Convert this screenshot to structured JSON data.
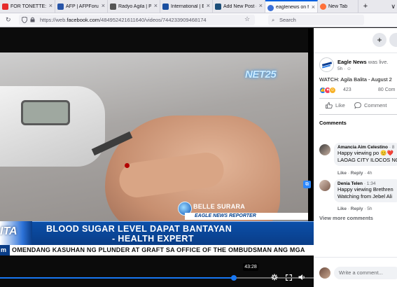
{
  "browser": {
    "tabs": [
      {
        "title": "FOR TONETTE:",
        "favicon_color": "#e62b2b",
        "active": false
      },
      {
        "title": "AFP | AFPForum",
        "favicon_color": "#2855a8",
        "active": false
      },
      {
        "title": "Radyo Agila | Pu",
        "favicon_color": "#555555",
        "active": false
      },
      {
        "title": "International | E",
        "favicon_color": "#1a4fa0",
        "active": false
      },
      {
        "title": "Add New Post ‹",
        "favicon_color": "#1d4f7a",
        "active": false
      },
      {
        "title": "eaglenews on fa",
        "favicon_color": "#3b6fd6",
        "active": true
      },
      {
        "title": "New Tab",
        "favicon_color": "#ff7139",
        "active": false
      }
    ],
    "new_tab_symbol": "+",
    "tab_menu_symbol": "∨",
    "url_prefix": "https://web.",
    "url_domain": "facebook.com",
    "url_path": "/484952421611640/videos/744233909468174",
    "search_placeholder": "Search",
    "star_symbol": "☆"
  },
  "video": {
    "watermark": "NET25",
    "reporter_name": "BELLE SURARA",
    "reporter_title": "EAGLE NEWS REPORTER",
    "logo_partial": "ITA",
    "headline_line1": "BLOOD SUGAR LEVEL DAPAT BANTAYAN",
    "headline_line2": "- HEALTH EXPERT",
    "ticker_label": "m",
    "ticker_text": "OMENDANG KASUHAN NG PLUNDER AT GRAFT SA OFFICE OF THE OMBUDSMAN ANG MGA",
    "time_tooltip": "43:28",
    "progress_fraction": 0.745
  },
  "sidebar": {
    "page_name": "Eagle News",
    "live_text": " was live.",
    "timestamp": "5h · ☺",
    "post_title": "WATCH: Agila Balita - August 2",
    "reaction_count": "423",
    "comment_count": "80 Com",
    "like_label": "Like",
    "comment_label": "Comment",
    "comments_heading": "Comments",
    "comments": [
      {
        "name": "Amancia Aim Celestino",
        "time": " · 8",
        "lines": [
          "Happy viewing po 😊❤️",
          "LAOAG CITY ILOCOS NO"
        ],
        "meta_like": "Like",
        "meta_reply": "Reply",
        "meta_age": "4h"
      },
      {
        "name": "Denia Telen",
        "time": " · 1:34",
        "lines": [
          "Happy viewing Brethren",
          "Watching from Jebel Ali"
        ],
        "meta_like": "Like",
        "meta_reply": "Reply",
        "meta_age": "5h"
      }
    ],
    "view_more": "View more comments",
    "write_placeholder": "Write a comment..."
  }
}
